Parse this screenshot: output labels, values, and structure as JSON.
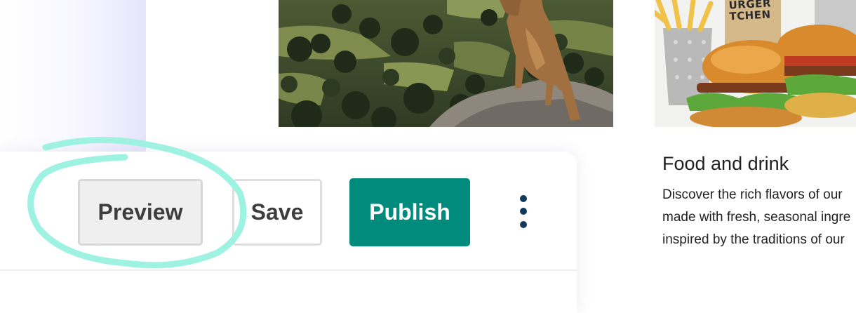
{
  "toolbar": {
    "preview_label": "Preview",
    "save_label": "Save",
    "publish_label": "Publish",
    "more_icon": "more-vertical-icon",
    "accent_color": "#008b7d"
  },
  "highlight": {
    "color": "#9ef2e2"
  },
  "cards": {
    "food": {
      "image_text": "BURGER KITCHEN",
      "image_line1": "URGER",
      "image_line2": "TCHEN",
      "title": "Food and drink",
      "desc_lines": [
        "Discover the rich flavors of our",
        "made with fresh, seasonal ingre",
        "inspired by the traditions of our"
      ]
    }
  }
}
